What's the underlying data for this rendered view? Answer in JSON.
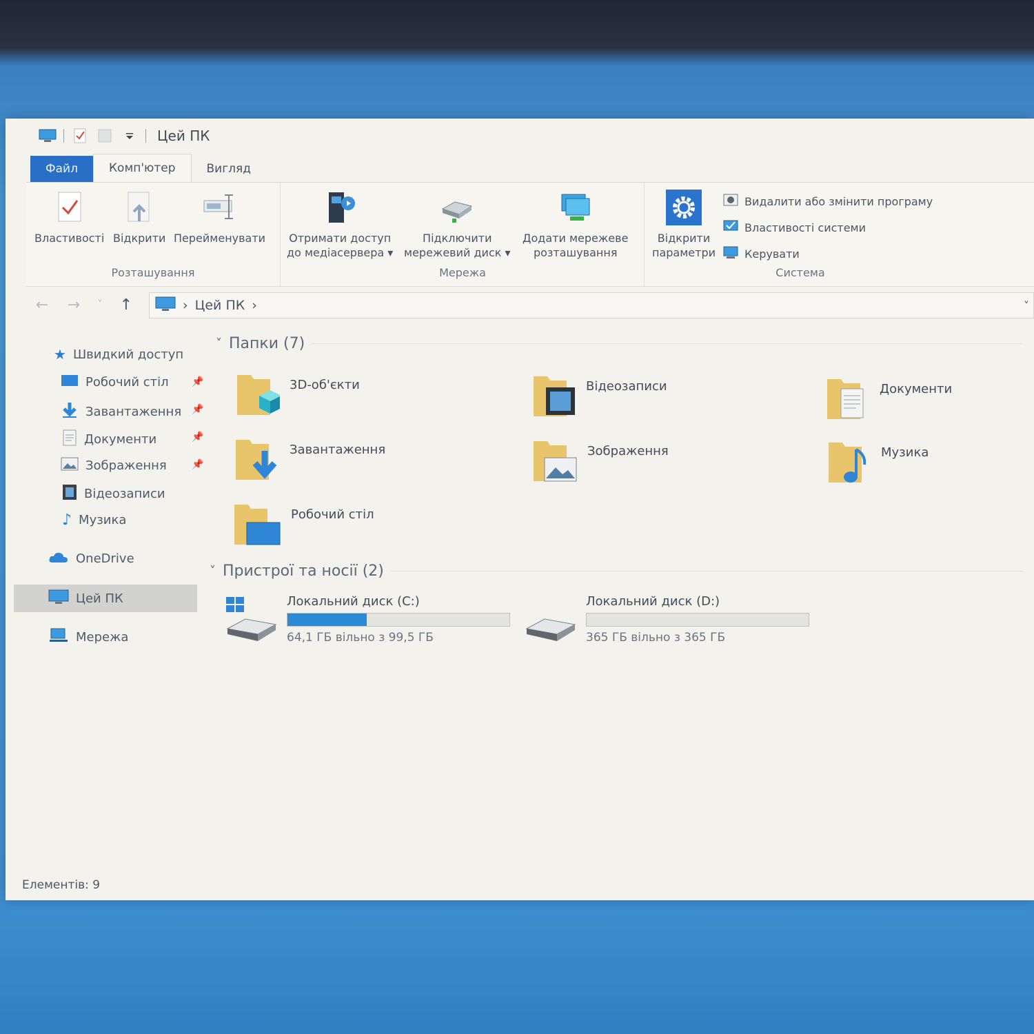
{
  "titlebar": {
    "title": "Цей ПК"
  },
  "tabs": [
    {
      "label": "Файл"
    },
    {
      "label": "Комп'ютер"
    },
    {
      "label": "Вигляд"
    }
  ],
  "ribbon": {
    "location": {
      "label": "Розташування",
      "properties": "Властивості",
      "open": "Відкрити",
      "rename": "Перейменувати"
    },
    "network": {
      "label": "Мережа",
      "media_line1": "Отримати доступ",
      "media_line2": "до медіасервера",
      "map_line1": "Підключити",
      "map_line2": "мережевий диск",
      "add_line1": "Додати мережеве",
      "add_line2": "розташування"
    },
    "system": {
      "label": "Система",
      "settings_line1": "Відкрити",
      "settings_line2": "параметри",
      "uninstall": "Видалити або змінити програму",
      "sysprops": "Властивості системи",
      "manage": "Керувати"
    }
  },
  "address": {
    "path": "Цей ПК"
  },
  "sidebar": {
    "quick_access": "Швидкий доступ",
    "items": [
      {
        "label": "Робочий стіл"
      },
      {
        "label": "Завантаження"
      },
      {
        "label": "Документи"
      },
      {
        "label": "Зображення"
      },
      {
        "label": "Відеозаписи"
      },
      {
        "label": "Музика"
      }
    ],
    "onedrive": "OneDrive",
    "this_pc": "Цей ПК",
    "network": "Мережа"
  },
  "folders": {
    "heading": "Папки (7)",
    "items": [
      {
        "label": "3D-об'єкти"
      },
      {
        "label": "Відеозаписи"
      },
      {
        "label": "Документи"
      },
      {
        "label": "Завантаження"
      },
      {
        "label": "Зображення"
      },
      {
        "label": "Музика"
      },
      {
        "label": "Робочий стіл"
      }
    ]
  },
  "devices": {
    "heading": "Пристрої та носії (2)",
    "drives": [
      {
        "name": "Локальний диск (C:)",
        "free": "64,1 ГБ вільно з 99,5 ГБ",
        "used_fraction": 0.356
      },
      {
        "name": "Локальний диск (D:)",
        "free": "365 ГБ вільно з 365 ГБ",
        "used_fraction": 0.0
      }
    ]
  },
  "status": {
    "items": "Елементів: 9"
  },
  "colors": {
    "accent": "#2a6fc6",
    "bar_fill": "#2a8ad4",
    "folder": "#e8c56a"
  }
}
